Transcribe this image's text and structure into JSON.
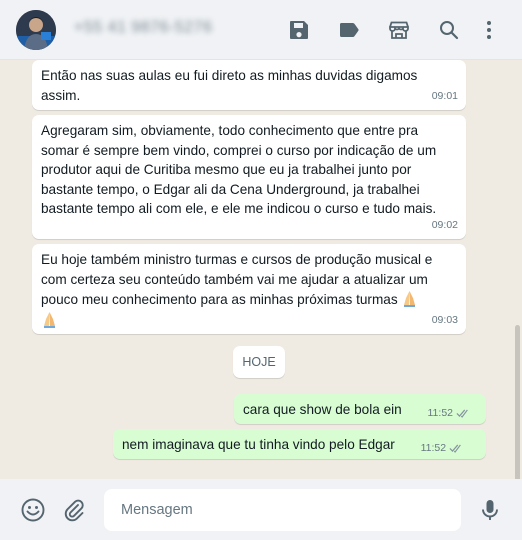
{
  "header": {
    "contact_name": "+55 41 9876-5276",
    "icons": [
      "save-icon",
      "label-icon",
      "store-icon",
      "search-icon",
      "menu-icon"
    ]
  },
  "messages": [
    {
      "direction": "in",
      "text": "Então nas suas aulas eu fui direto as minhas duvidas digamos assim.",
      "time": "09:01"
    },
    {
      "direction": "in",
      "text": "Agregaram sim, obviamente, todo conhecimento que entre pra somar é sempre bem vindo, comprei o curso por indicação de um produtor aqui de Curitiba mesmo que eu ja trabalhei junto por bastante tempo, o Edgar ali da Cena Underground, ja trabalhei bastante tempo ali com ele, e ele me indicou o curso e tudo mais.",
      "time": "09:02"
    },
    {
      "direction": "in",
      "text": "Eu hoje também ministro turmas e cursos de produção musical e com certeza seu conteúdo também vai me ajudar a atualizar um pouco meu conhecimento para as minhas próximas turmas",
      "time": "09:03"
    },
    {
      "direction": "out",
      "text": "cara que show de bola ein",
      "time": "11:52"
    },
    {
      "direction": "out",
      "text": "nem imaginava que tu tinha vindo pelo Edgar",
      "time": "11:52"
    }
  ],
  "day_label": "HOJE",
  "footer": {
    "placeholder": "Mensagem"
  },
  "colors": {
    "incoming": "#ffffff",
    "outgoing": "#d9fdd3",
    "background": "#efeae2",
    "bar": "#f0f2f5",
    "tick": "#8696a0"
  }
}
